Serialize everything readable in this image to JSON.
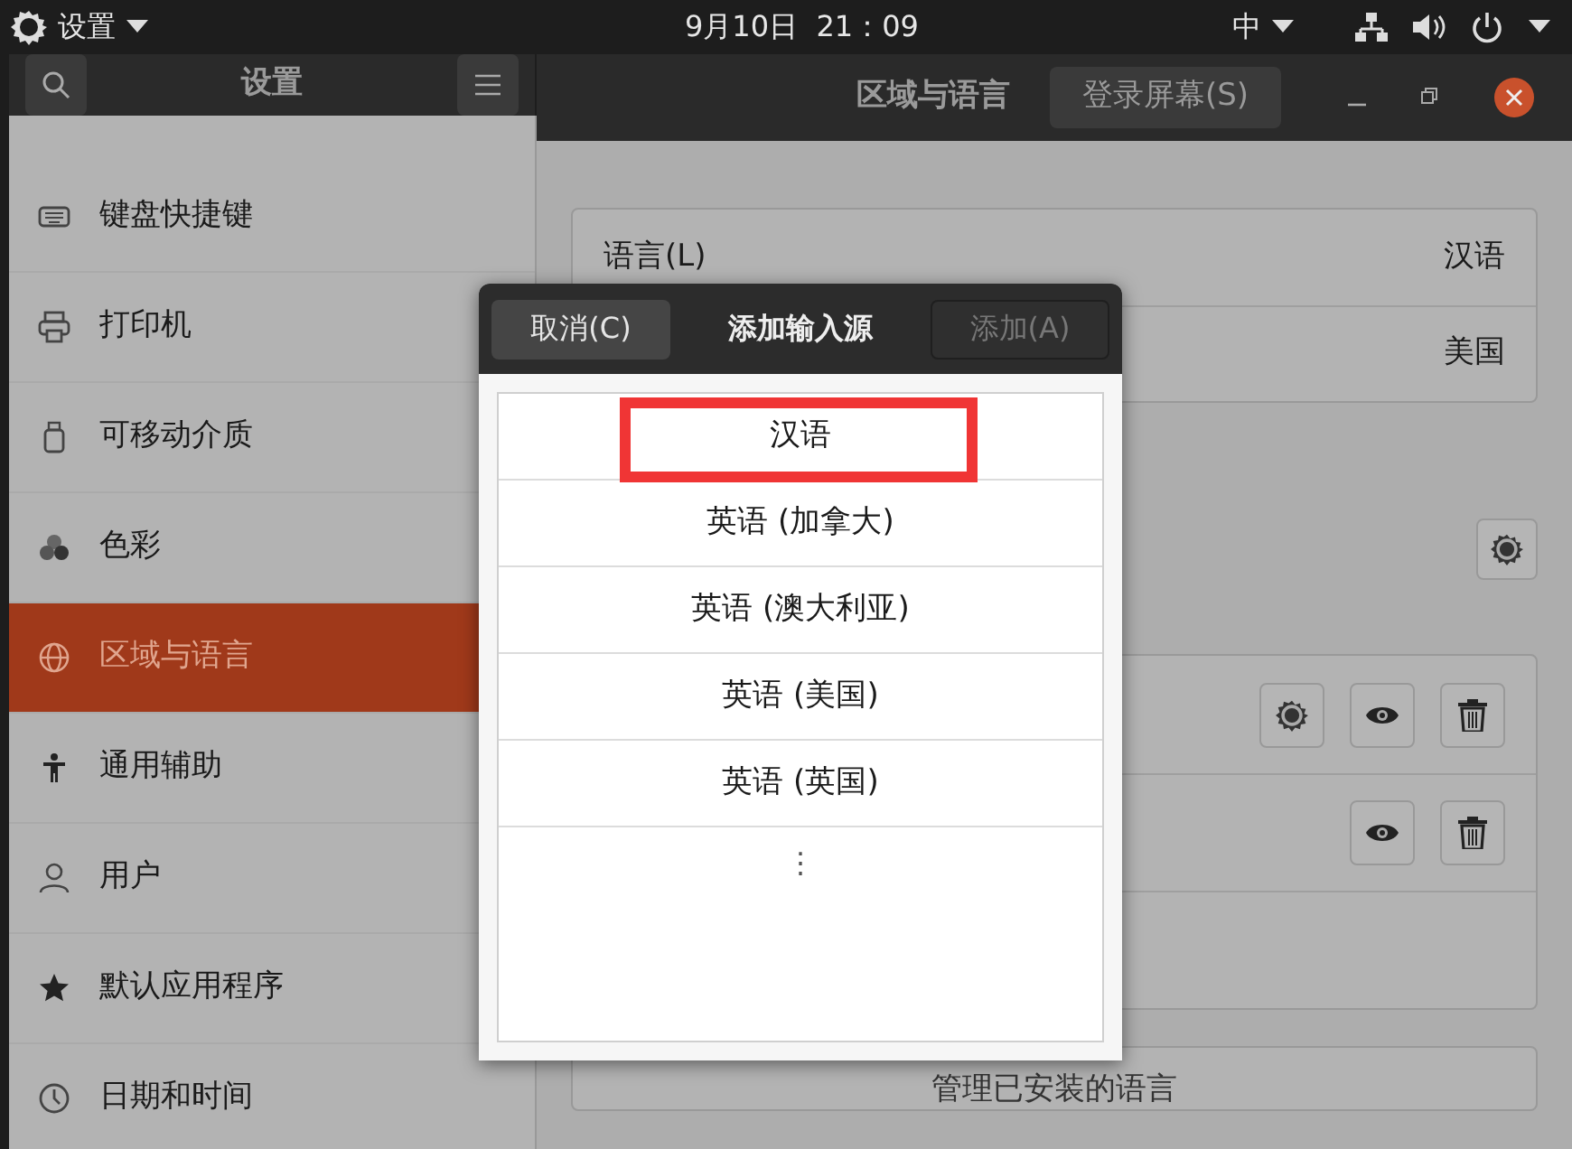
{
  "top_bar": {
    "app_menu": "设置",
    "clock": "9月10日  21：09",
    "input_method": "中"
  },
  "header": {
    "sidebar_title": "设置",
    "page_title": "区域与语言",
    "login_screen_button": "登录屏幕(S)"
  },
  "sidebar": {
    "items": [
      {
        "kind": "keyboard",
        "label": "键盘快捷键",
        "selected": false
      },
      {
        "kind": "printer",
        "label": "打印机",
        "selected": false
      },
      {
        "kind": "usb",
        "label": "可移动介质",
        "selected": false
      },
      {
        "kind": "color",
        "label": "色彩",
        "selected": false
      },
      {
        "kind": "globe",
        "label": "区域与语言",
        "selected": true
      },
      {
        "kind": "accessibility",
        "label": "通用辅助",
        "selected": false
      },
      {
        "kind": "user",
        "label": "用户",
        "selected": false
      },
      {
        "kind": "star",
        "label": "默认应用程序",
        "selected": false
      },
      {
        "kind": "clock",
        "label": "日期和时间",
        "selected": false
      }
    ]
  },
  "language_card": {
    "rows": [
      {
        "label": "语言(L)",
        "value": "汉语"
      },
      {
        "value": "美国"
      }
    ]
  },
  "input_sources": [
    {
      "kind": "source",
      "buttons": [
        {
          "kind": "settings"
        },
        {
          "kind": "preview"
        },
        {
          "kind": "remove"
        }
      ]
    },
    {
      "kind": "source",
      "buttons": [
        {
          "kind": "preview"
        },
        {
          "kind": "remove"
        }
      ]
    },
    {
      "kind": "blank"
    }
  ],
  "manage_button": "管理已安装的语言",
  "dialog": {
    "cancel": "取消(C)",
    "title": "添加输入源",
    "add": {
      "label": "添加(A)",
      "disabled": true
    },
    "items": [
      {
        "label": "汉语",
        "highlighted": true
      },
      {
        "label": "英语 (加拿大)",
        "highlighted": false
      },
      {
        "label": "英语 (澳大利亚)",
        "highlighted": false
      },
      {
        "label": "英语 (美国)",
        "highlighted": false
      },
      {
        "label": "英语 (英国)",
        "highlighted": false
      }
    ],
    "more": "⋮"
  }
}
